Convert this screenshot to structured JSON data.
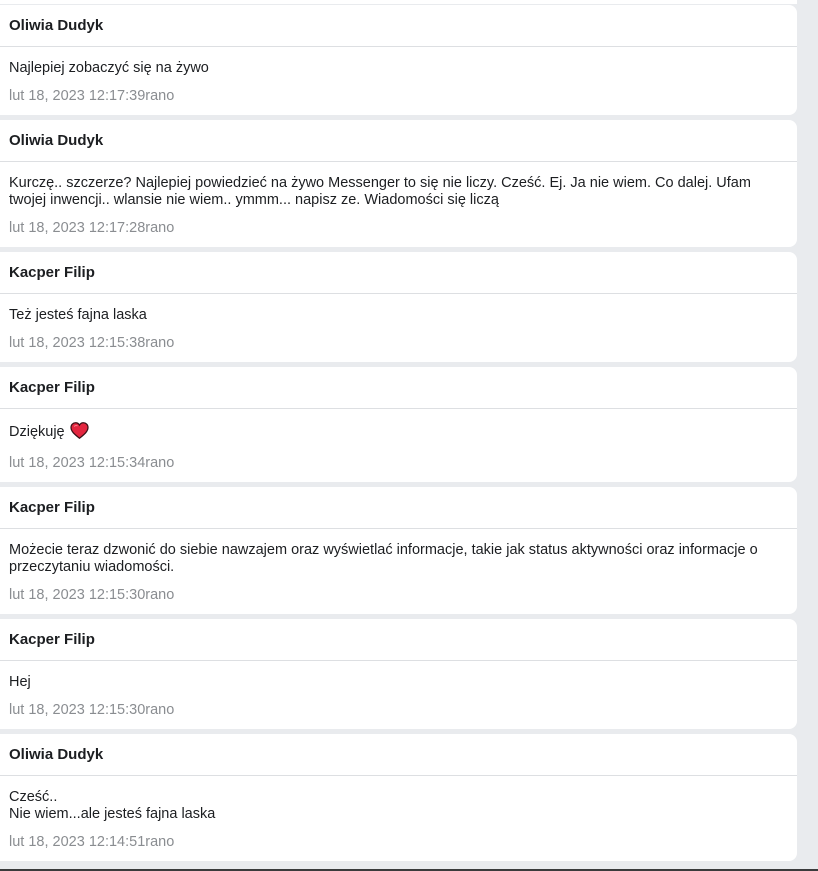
{
  "messages": [
    {
      "sender": "Oliwia Dudyk",
      "text": "Najlepiej zobaczyć się na żywo",
      "timestamp": "lut 18, 2023 12:17:39rano"
    },
    {
      "sender": "Oliwia Dudyk",
      "text": "Kurczę.. szczerze? Najlepiej powiedzieć na żywo Messenger to się nie liczy. Cześć. Ej. Ja nie wiem. Co dalej. Ufam\ntwojej inwencji.. wlansie nie wiem.. ymmm... napisz ze. Wiadomości się liczą",
      "timestamp": "lut 18, 2023 12:17:28rano"
    },
    {
      "sender": "Kacper Filip",
      "text": "Też jesteś fajna laska",
      "timestamp": "lut 18, 2023 12:15:38rano"
    },
    {
      "sender": "Kacper Filip",
      "text": "Dziękuję",
      "emoji": "heart-icon",
      "timestamp": "lut 18, 2023 12:15:34rano"
    },
    {
      "sender": "Kacper Filip",
      "text": "Możecie teraz dzwonić do siebie nawzajem oraz wyświetlać informacje, takie jak status aktywności oraz informacje o\nprzeczytaniu wiadomości.",
      "timestamp": "lut 18, 2023 12:15:30rano"
    },
    {
      "sender": "Kacper Filip",
      "text": "Hej",
      "timestamp": "lut 18, 2023 12:15:30rano"
    },
    {
      "sender": "Oliwia Dudyk",
      "text": "Cześć..\nNie wiem...ale jesteś fajna laska",
      "timestamp": "lut 18, 2023 12:14:51rano"
    }
  ],
  "colors": {
    "background": "#e9ebee",
    "card": "#ffffff",
    "timestamp": "#8a8d91",
    "heart": "#e0245e"
  }
}
